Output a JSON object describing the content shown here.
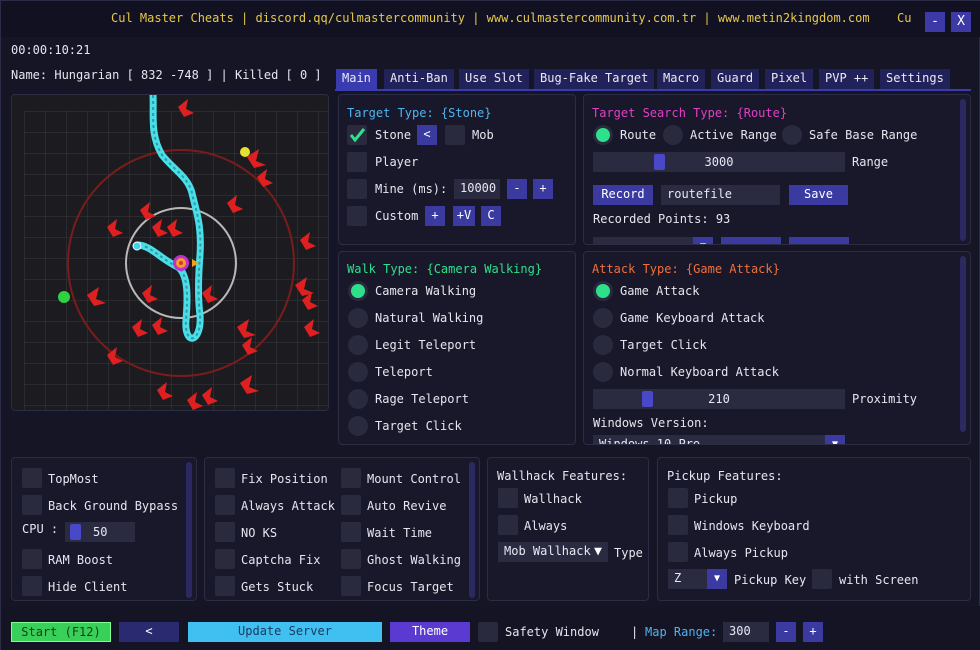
{
  "title_bar": {
    "text": "Cul Master Cheats | discord.qq/culmastercommunity | www.culmastercommunity.com.tr | www.metin2kingdom.com",
    "right_text": "Cu",
    "minimize_label": "-",
    "close_label": "X"
  },
  "timer": "00:00:10:21",
  "status_line": "Name: Hungarian [ 832 -748 ] | Killed [ 0 ]",
  "tabs": [
    "Main",
    "Anti-Ban",
    "Use Slot",
    "Bug-Fake Target",
    "Macro",
    "Guard",
    "Pixel",
    "PVP ++",
    "Settings"
  ],
  "active_tab": "Main",
  "target_type": {
    "header": "Target Type: {Stone}",
    "stone": "Stone",
    "stone_checked": true,
    "stone_btn": "<",
    "mob": "Mob",
    "player": "Player",
    "mine": "Mine (ms):",
    "mine_value": "10000",
    "mine_minus": "-",
    "mine_plus": "+",
    "custom": "Custom",
    "custom_plus": "+",
    "custom_plusv": "+V",
    "custom_c": "C"
  },
  "target_search": {
    "header": "Target Search Type: {Route}",
    "route": "Route",
    "active_range": "Active Range",
    "safe_base_range": "Safe Base Range",
    "range_value": "3000",
    "range_fraction": 0.5,
    "range_label": "Range",
    "record_btn": "Record",
    "route_file": "routefile",
    "save_btn": "Save",
    "recorded_points": "Recorded Points: 93"
  },
  "walk_type": {
    "header": "Walk Type: {Camera Walking}",
    "options": [
      "Camera Walking",
      "Natural Walking",
      "Legit Teleport",
      "Teleport",
      "Rage Teleport",
      "Target Click"
    ],
    "selected": 0
  },
  "attack_type": {
    "header": "Attack Type: {Game Attack}",
    "options": [
      "Game Attack",
      "Game Keyboard Attack",
      "Target Click",
      "Normal Keyboard Attack"
    ],
    "selected": 0,
    "proximity_value": "210",
    "proximity_fraction": 0.2,
    "proximity_label": "Proximity",
    "windows_version_label": "Windows Version:",
    "windows_version_value": "Windows 10 Pro"
  },
  "misc": {
    "topmost": "TopMost",
    "background_bypass": "Back Ground Bypass",
    "cpu_label": "CPU :",
    "cpu_value": "50",
    "cpu_fraction": 0.05,
    "ram_boost": "RAM Boost",
    "hide_client": "Hide Client"
  },
  "options": {
    "left": [
      "Fix Position",
      "Always Attack",
      "NO KS",
      "Captcha Fix",
      "Gets Stuck"
    ],
    "right": [
      "Mount Control",
      "Auto Revive",
      "Wait Time",
      "Ghost Walking",
      "Focus Target"
    ]
  },
  "wallhack": {
    "header": "Wallhack Features:",
    "wallhack": "Wallhack",
    "always": "Always",
    "combo_value": "Mob Wallhack",
    "type_label": "Type"
  },
  "pickup": {
    "header": "Pickup Features:",
    "pickup": "Pickup",
    "windows_keyboard": "Windows Keyboard",
    "always_pickup": "Always Pickup",
    "key_value": "Z",
    "pickup_key_label": "Pickup Key",
    "with_screen": "with Screen"
  },
  "bottom": {
    "start": "Start (F12)",
    "back": "<",
    "update": "Update Server",
    "theme": "Theme",
    "safety_window": "Safety Window",
    "separator": "|",
    "map_range_label": "Map Range:",
    "map_range_value": "300",
    "minus": "-",
    "plus": "+"
  },
  "colors": {
    "accent": "#3b3bb0",
    "title": "#e6c84a",
    "header_blue": "#4fb4f0",
    "header_pink": "#e040c8",
    "header_green": "#2ee08a",
    "header_orange": "#f0703a",
    "start_green": "#39d05a",
    "update_cyan": "#40c0f0",
    "theme_purple": "#5a3ad0"
  }
}
